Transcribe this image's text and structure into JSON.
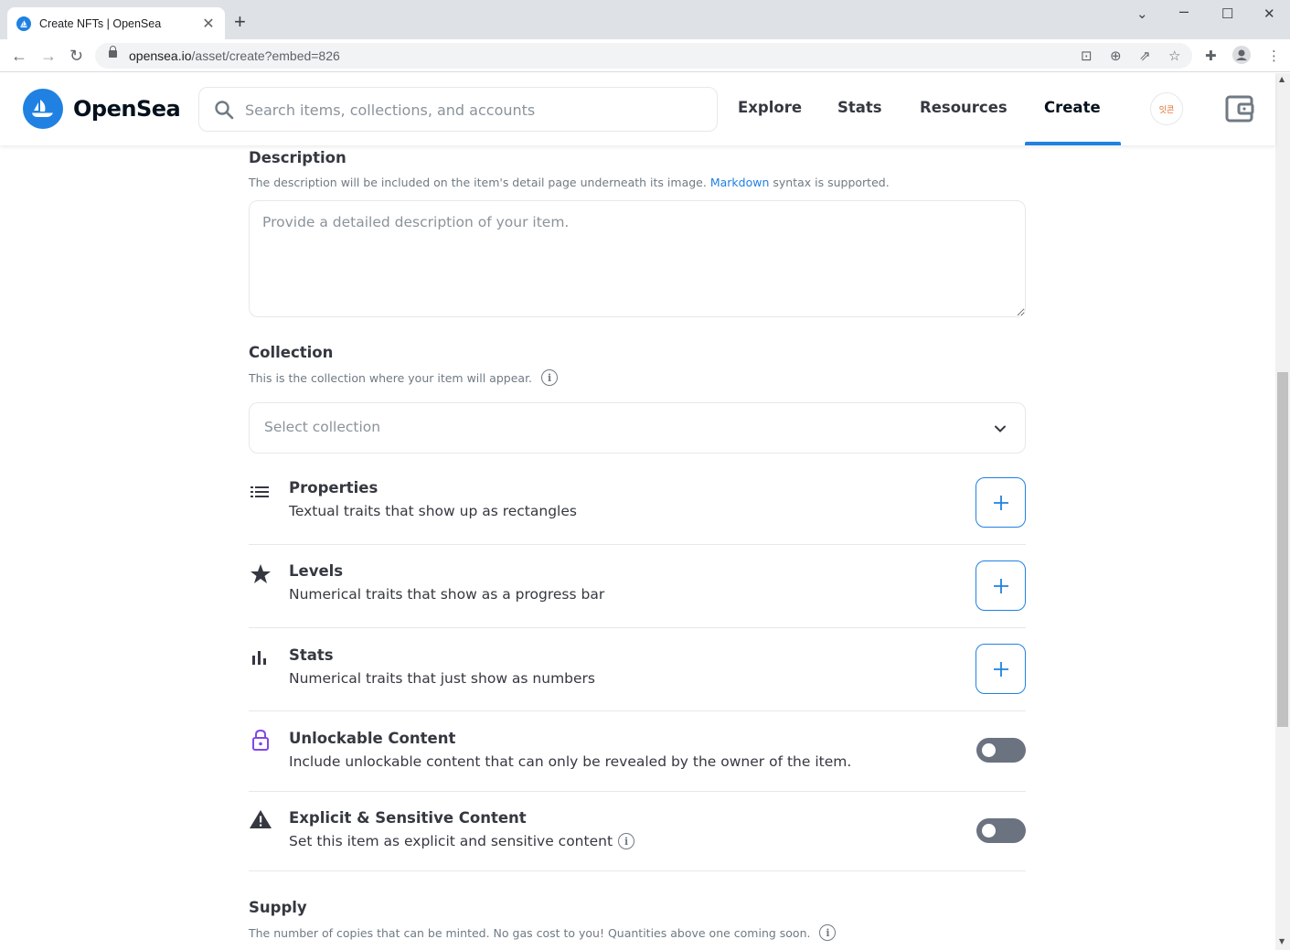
{
  "browser": {
    "tab_title": "Create NFTs | OpenSea",
    "url_host": "opensea.io",
    "url_path": "/asset/create?embed=826"
  },
  "header": {
    "brand": "OpenSea",
    "search_placeholder": "Search items, collections, and accounts",
    "nav": [
      "Explore",
      "Stats",
      "Resources",
      "Create"
    ],
    "active_nav": "Create",
    "avatar_text": "잇콘",
    "accent": "#2081e2"
  },
  "description": {
    "title": "Description",
    "help_prefix": "The description will be included on the item's detail page underneath its image.",
    "help_link": "Markdown",
    "help_suffix": "syntax is supported.",
    "placeholder": "Provide a detailed description of your item."
  },
  "collection": {
    "title": "Collection",
    "help": "This is the collection where your item will appear.",
    "select_value": "Select collection"
  },
  "traits": [
    {
      "name": "Properties",
      "desc": "Textual traits that show up as rectangles",
      "icon": "list-icon",
      "control": "add"
    },
    {
      "name": "Levels",
      "desc": "Numerical traits that show as a progress bar",
      "icon": "star-icon",
      "control": "add"
    },
    {
      "name": "Stats",
      "desc": "Numerical traits that just show as numbers",
      "icon": "bar-chart-icon",
      "control": "add"
    },
    {
      "name": "Unlockable Content",
      "desc": "Include unlockable content that can only be revealed by the owner of the item.",
      "icon": "lock-icon",
      "control": "toggle"
    },
    {
      "name": "Explicit & Sensitive Content",
      "desc": "Set this item as explicit and sensitive content",
      "icon": "warning-icon",
      "control": "toggle"
    }
  ],
  "supply": {
    "title": "Supply",
    "help": "The number of copies that can be minted. No gas cost to you! Quantities above one coming soon."
  }
}
